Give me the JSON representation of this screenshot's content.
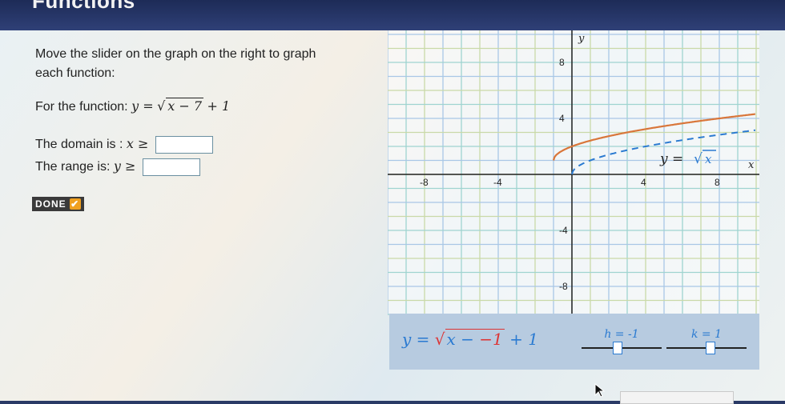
{
  "header": {
    "title": "Functions"
  },
  "instructions": {
    "line1": "Move the slider on the graph on the right to graph",
    "line2": "each function:"
  },
  "function": {
    "prefix": "For the function:",
    "lhs": "y =",
    "radicand": "x − 7",
    "tail": "+ 1"
  },
  "domain": {
    "label": "The domain is :",
    "var": "x ≥",
    "value": ""
  },
  "range": {
    "label": "The range is:",
    "var": "y ≥",
    "value": ""
  },
  "done_button": {
    "label": "DONE",
    "check": "✔"
  },
  "graph": {
    "y_axis_label": "y",
    "x_axis_label": "x",
    "parent_label_lhs": "y =",
    "parent_label_radicand": "x",
    "x_ticks": [
      "-8",
      "-4",
      "4",
      "8"
    ],
    "y_ticks": [
      "8",
      "4",
      "-4",
      "-8"
    ],
    "parent_color": "#2a7ad1",
    "user_color": "#d9763a"
  },
  "controls": {
    "eq_lhs": "y =",
    "eq_radicand_a": "x −",
    "eq_radicand_b": "−1",
    "eq_tail": "+ 1",
    "h_label": "h = -1",
    "h_value": -1,
    "k_label": "k = 1",
    "k_value": 1
  },
  "chart_data": {
    "type": "line",
    "x_range": [
      -10,
      10
    ],
    "y_range": [
      -10,
      10
    ],
    "grid": true,
    "series": [
      {
        "name": "y = √x",
        "style": "dashed",
        "color": "#2a7ad1",
        "h": 0,
        "k": 0
      },
      {
        "style": "solid",
        "color": "#d9763a",
        "h": -1,
        "k": 1
      }
    ]
  }
}
